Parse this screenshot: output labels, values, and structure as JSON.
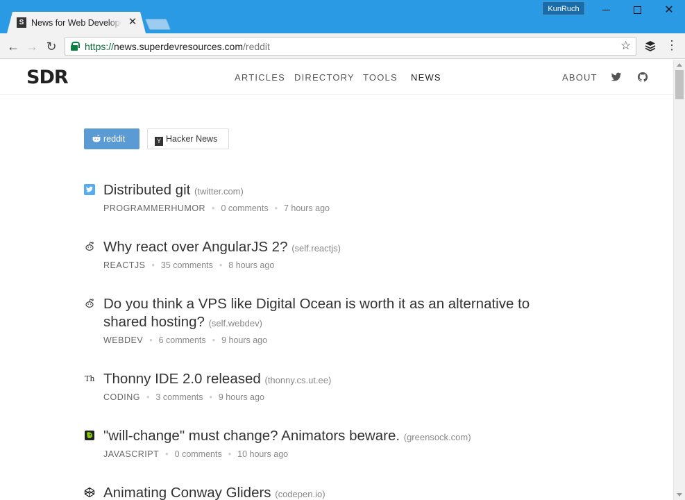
{
  "browser": {
    "tab_title": "News for Web Developers",
    "tab_favicon": "S",
    "profile_name": "KunRuch",
    "url_scheme": "https://",
    "url_host": "news.superdevresources.com",
    "url_path": "/reddit"
  },
  "site": {
    "logo": "SDR",
    "nav": [
      "ARTICLES",
      "DIRECTORY",
      "TOOLS",
      "NEWS"
    ],
    "nav_right": "ABOUT",
    "sources": {
      "reddit": "reddit",
      "hacker_news": "Hacker News"
    }
  },
  "posts": [
    {
      "icon": "twitter-icon",
      "title": "Distributed git",
      "domain": "(twitter.com)",
      "subreddit": "PROGRAMMERHUMOR",
      "comments": "0 comments",
      "time": "7 hours ago"
    },
    {
      "icon": "reddit-alien-icon",
      "title": "Why react over AngularJS 2?",
      "domain": "(self.reactjs)",
      "subreddit": "REACTJS",
      "comments": "35 comments",
      "time": "8 hours ago"
    },
    {
      "icon": "reddit-alien-icon",
      "title": "Do you think a VPS like Digital Ocean is worth it as an alternative to shared hosting?",
      "domain": "(self.webdev)",
      "subreddit": "WEBDEV",
      "comments": "6 comments",
      "time": "9 hours ago"
    },
    {
      "icon": "thonny-icon",
      "title": "Thonny IDE 2.0 released",
      "domain": "(thonny.cs.ut.ee)",
      "subreddit": "CODING",
      "comments": "3 comments",
      "time": "9 hours ago"
    },
    {
      "icon": "greensock-icon",
      "title": "\"will-change\" must change? Animators beware.",
      "domain": "(greensock.com)",
      "subreddit": "JAVASCRIPT",
      "comments": "0 comments",
      "time": "10 hours ago"
    },
    {
      "icon": "codepen-icon",
      "title": "Animating Conway Gliders",
      "domain": "(codepen.io)"
    }
  ],
  "colors": {
    "titlebar": "#2a9ae5",
    "reddit_button": "#5b9bd5",
    "secure_url": "#0b8043"
  }
}
